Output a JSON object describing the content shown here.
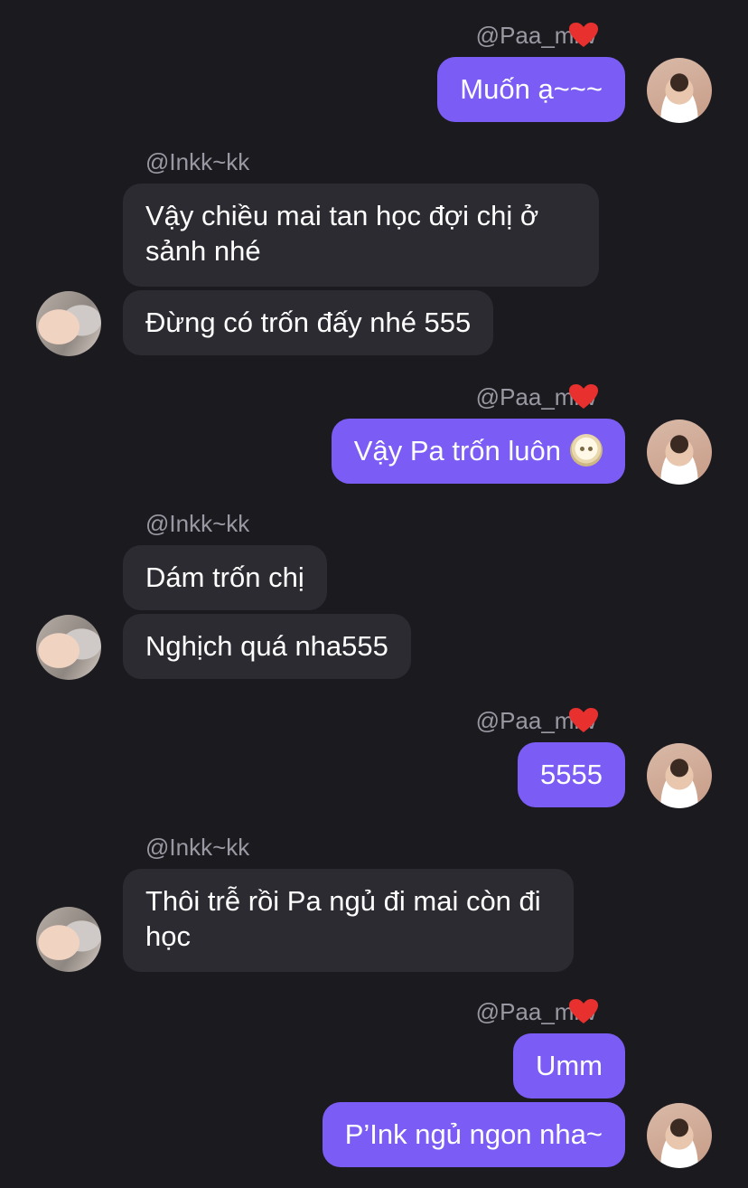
{
  "colors": {
    "background": "#1b1a1f",
    "outgoing_bubble": "#7b5cf4",
    "incoming_bubble": "#2c2b31",
    "username": "#9a99a3",
    "heart": "#e8312f"
  },
  "users": {
    "me": {
      "handle": "@Paa_miw",
      "suffix_icon": "red-heart-emoji"
    },
    "them": {
      "handle": "@Inkk~kk"
    }
  },
  "messages": [
    {
      "sender": "me",
      "text": "Muốn ạ~~~"
    },
    {
      "sender": "them",
      "text": "Vậy chiều mai tan học đợi chị ở sảnh nhé"
    },
    {
      "sender": "them",
      "text": "Đừng có trốn đấy nhé 555"
    },
    {
      "sender": "me",
      "text": "Vậy Pa trốn luôn",
      "emoji": "face-in-clouds-emoji"
    },
    {
      "sender": "them",
      "text": "Dám trốn chị"
    },
    {
      "sender": "them",
      "text": "Nghịch quá nha555"
    },
    {
      "sender": "me",
      "text": "5555"
    },
    {
      "sender": "them",
      "text": "Thôi trễ rồi Pa ngủ đi mai còn đi học"
    },
    {
      "sender": "me",
      "text": "Umm"
    },
    {
      "sender": "me",
      "text": "P’Ink ngủ ngon nha~"
    }
  ]
}
